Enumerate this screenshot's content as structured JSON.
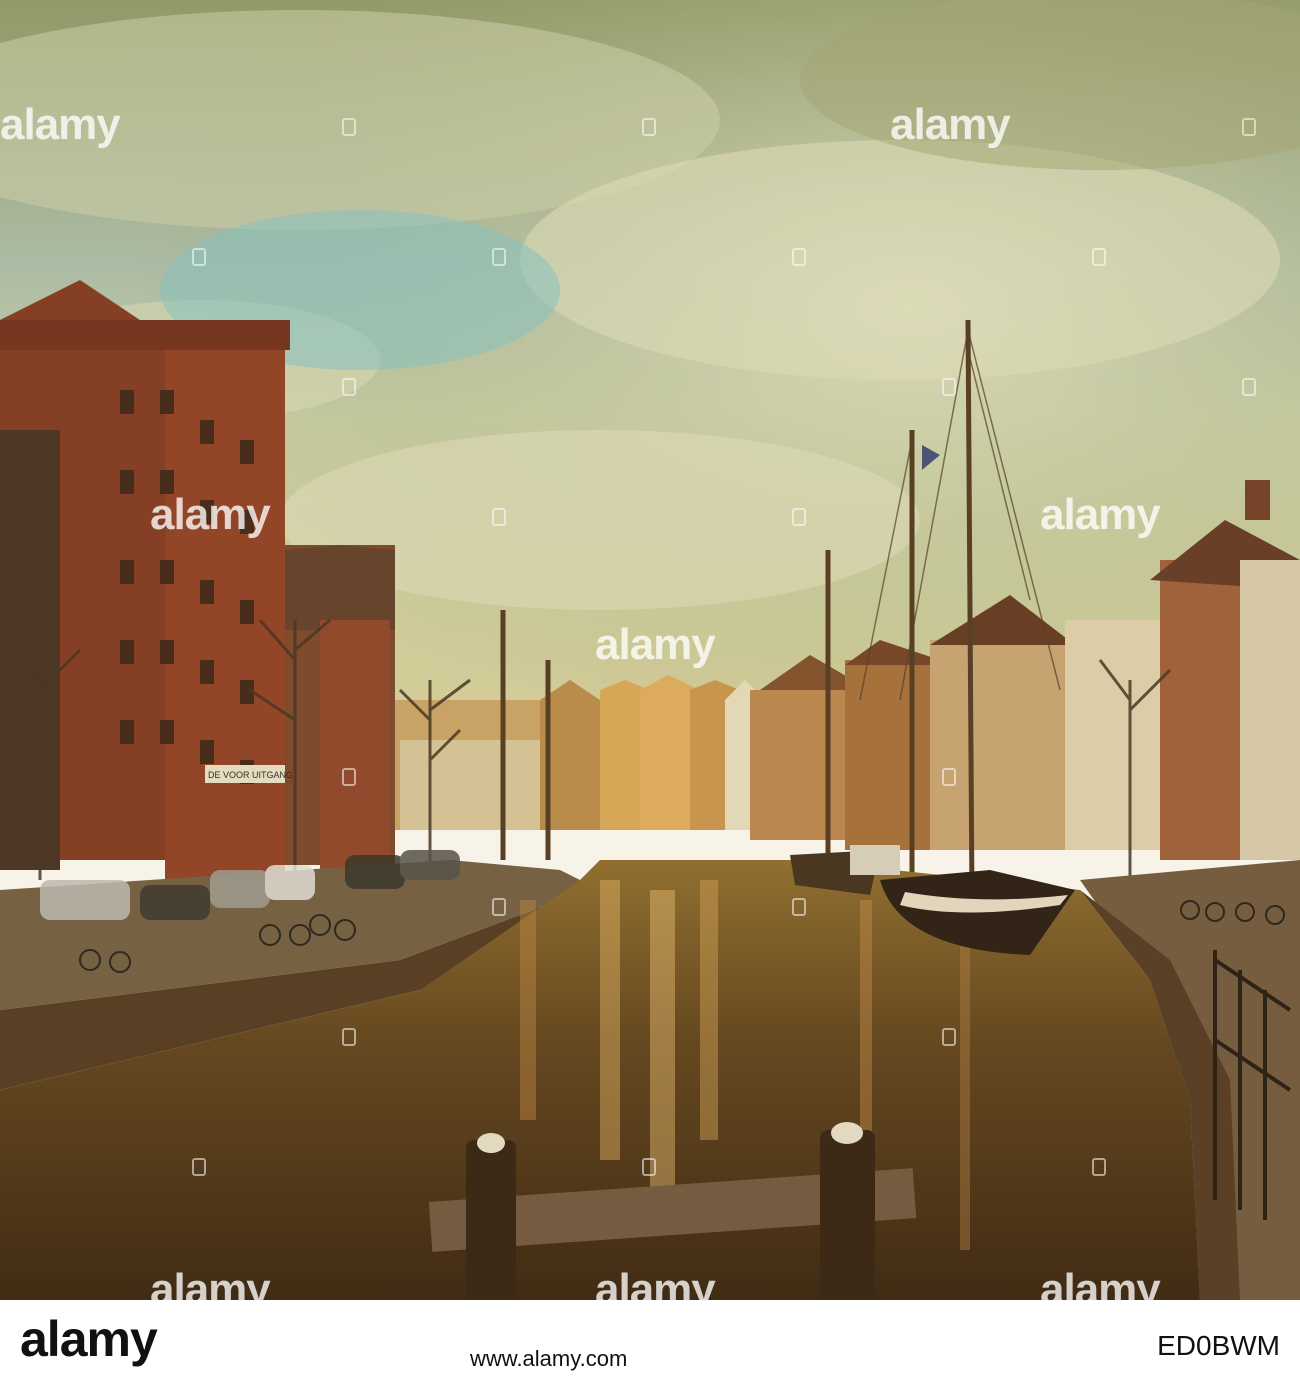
{
  "photo": {
    "scene": "canal",
    "watermark_text": "alamy",
    "sign_text": "DE VOOR UITGANG"
  },
  "footer": {
    "logo": "alamy",
    "image_id": "ED0BWM",
    "url": "www.alamy.com"
  }
}
